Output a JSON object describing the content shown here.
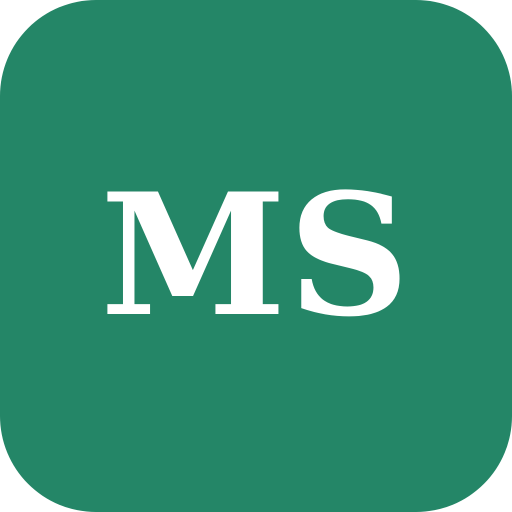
{
  "icon": {
    "monogram": "MS",
    "background_color": "#248667",
    "text_color": "#ffffff"
  }
}
